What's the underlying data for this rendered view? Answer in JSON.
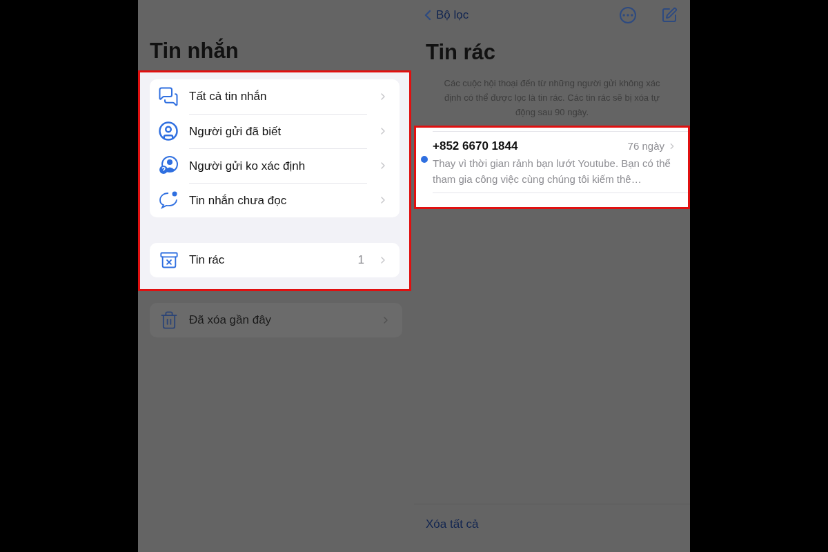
{
  "left_screen": {
    "title": "Tin nhắn",
    "filters": {
      "highlighted": true,
      "items": [
        {
          "kind": "bubbles",
          "label": "Tất cả tin nhắn"
        },
        {
          "kind": "person",
          "label": "Người gửi đã biết"
        },
        {
          "kind": "unknown-person",
          "label": "Người gửi ko xác định"
        },
        {
          "kind": "unread",
          "label": "Tin nhắn chưa đọc"
        }
      ],
      "junk": {
        "label": "Tin rác",
        "count": "1"
      }
    },
    "recently_deleted": {
      "label": "Đã xóa gần đây"
    }
  },
  "right_screen": {
    "back": "Bộ lọc",
    "title": "Tin rác",
    "description": "Các cuộc hội thoại đến từ những người gửi không xác định có thể được lọc là tin rác. Các tin rác sẽ bị xóa tự động sau 90 ngày.",
    "messages": {
      "highlighted": true,
      "items": [
        {
          "sender": "+852 6670 1844",
          "date": "76 ngày",
          "preview": "Thay vì thời gian rảnh bạn lướt Youtube.  Bạn có thể tham gia công việc cùng chúng tôi  kiếm thê…",
          "unread": true
        }
      ]
    },
    "footer_action": "Xóa tất cả"
  }
}
